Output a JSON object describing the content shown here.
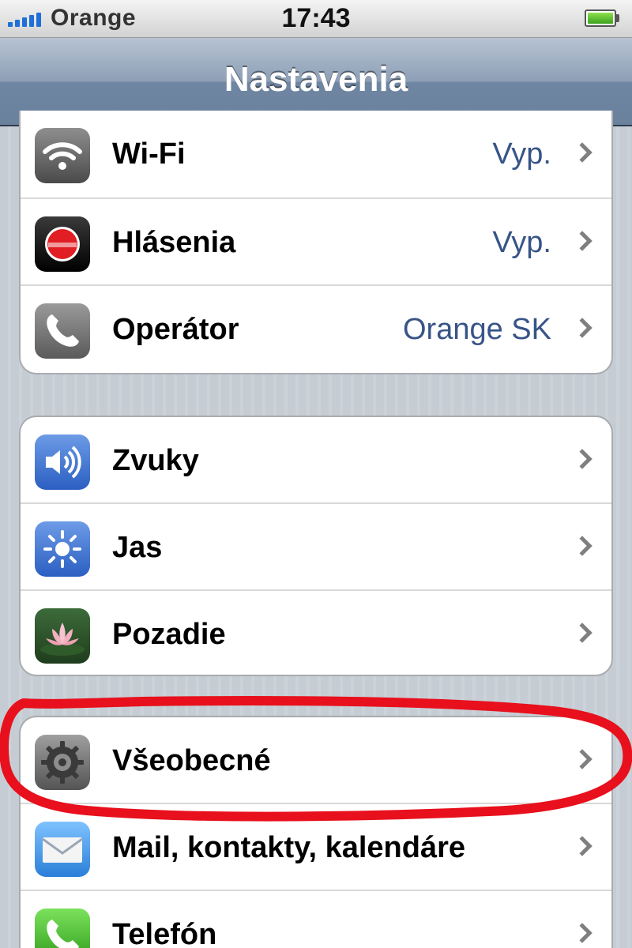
{
  "status_bar": {
    "carrier": "Orange",
    "time": "17:43",
    "colors": {
      "signal": "#1f6fd6",
      "battery": "#3aa31b"
    }
  },
  "nav": {
    "title": "Nastavenia"
  },
  "groups": [
    {
      "rows": [
        {
          "label": "Wi-Fi",
          "value": "Vyp.",
          "icon": "wifi-icon"
        },
        {
          "label": "Hlásenia",
          "value": "Vyp.",
          "icon": "notifications-icon"
        },
        {
          "label": "Operátor",
          "value": "Orange SK",
          "icon": "phone-handset-icon"
        }
      ]
    },
    {
      "rows": [
        {
          "label": "Zvuky",
          "icon": "speaker-icon"
        },
        {
          "label": "Jas",
          "icon": "sun-icon"
        },
        {
          "label": "Pozadie",
          "icon": "lotus-flower-icon"
        }
      ]
    },
    {
      "rows": [
        {
          "label": "Všeobecné",
          "icon": "gear-icon",
          "highlighted": true
        },
        {
          "label": "Mail, kontakty, kalendáre",
          "icon": "envelope-icon"
        },
        {
          "label": "Telefón",
          "icon": "phone-icon"
        }
      ]
    }
  ],
  "colors": {
    "value_text": "#385487",
    "highlight": "#e8101c",
    "background": "#c5ccd4"
  }
}
